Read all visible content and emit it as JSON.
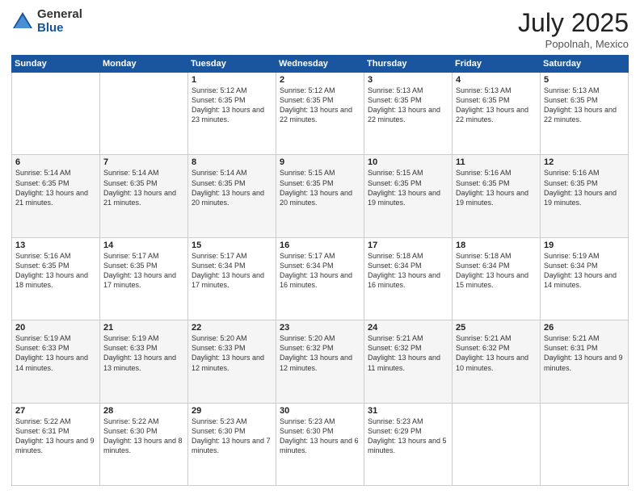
{
  "logo": {
    "general": "General",
    "blue": "Blue"
  },
  "title": "July 2025",
  "location": "Popolnah, Mexico",
  "days_header": [
    "Sunday",
    "Monday",
    "Tuesday",
    "Wednesday",
    "Thursday",
    "Friday",
    "Saturday"
  ],
  "weeks": [
    [
      {
        "day": "",
        "sunrise": "",
        "sunset": "",
        "daylight": ""
      },
      {
        "day": "",
        "sunrise": "",
        "sunset": "",
        "daylight": ""
      },
      {
        "day": "1",
        "sunrise": "Sunrise: 5:12 AM",
        "sunset": "Sunset: 6:35 PM",
        "daylight": "Daylight: 13 hours and 23 minutes."
      },
      {
        "day": "2",
        "sunrise": "Sunrise: 5:12 AM",
        "sunset": "Sunset: 6:35 PM",
        "daylight": "Daylight: 13 hours and 22 minutes."
      },
      {
        "day": "3",
        "sunrise": "Sunrise: 5:13 AM",
        "sunset": "Sunset: 6:35 PM",
        "daylight": "Daylight: 13 hours and 22 minutes."
      },
      {
        "day": "4",
        "sunrise": "Sunrise: 5:13 AM",
        "sunset": "Sunset: 6:35 PM",
        "daylight": "Daylight: 13 hours and 22 minutes."
      },
      {
        "day": "5",
        "sunrise": "Sunrise: 5:13 AM",
        "sunset": "Sunset: 6:35 PM",
        "daylight": "Daylight: 13 hours and 22 minutes."
      }
    ],
    [
      {
        "day": "6",
        "sunrise": "Sunrise: 5:14 AM",
        "sunset": "Sunset: 6:35 PM",
        "daylight": "Daylight: 13 hours and 21 minutes."
      },
      {
        "day": "7",
        "sunrise": "Sunrise: 5:14 AM",
        "sunset": "Sunset: 6:35 PM",
        "daylight": "Daylight: 13 hours and 21 minutes."
      },
      {
        "day": "8",
        "sunrise": "Sunrise: 5:14 AM",
        "sunset": "Sunset: 6:35 PM",
        "daylight": "Daylight: 13 hours and 20 minutes."
      },
      {
        "day": "9",
        "sunrise": "Sunrise: 5:15 AM",
        "sunset": "Sunset: 6:35 PM",
        "daylight": "Daylight: 13 hours and 20 minutes."
      },
      {
        "day": "10",
        "sunrise": "Sunrise: 5:15 AM",
        "sunset": "Sunset: 6:35 PM",
        "daylight": "Daylight: 13 hours and 19 minutes."
      },
      {
        "day": "11",
        "sunrise": "Sunrise: 5:16 AM",
        "sunset": "Sunset: 6:35 PM",
        "daylight": "Daylight: 13 hours and 19 minutes."
      },
      {
        "day": "12",
        "sunrise": "Sunrise: 5:16 AM",
        "sunset": "Sunset: 6:35 PM",
        "daylight": "Daylight: 13 hours and 19 minutes."
      }
    ],
    [
      {
        "day": "13",
        "sunrise": "Sunrise: 5:16 AM",
        "sunset": "Sunset: 6:35 PM",
        "daylight": "Daylight: 13 hours and 18 minutes."
      },
      {
        "day": "14",
        "sunrise": "Sunrise: 5:17 AM",
        "sunset": "Sunset: 6:35 PM",
        "daylight": "Daylight: 13 hours and 17 minutes."
      },
      {
        "day": "15",
        "sunrise": "Sunrise: 5:17 AM",
        "sunset": "Sunset: 6:34 PM",
        "daylight": "Daylight: 13 hours and 17 minutes."
      },
      {
        "day": "16",
        "sunrise": "Sunrise: 5:17 AM",
        "sunset": "Sunset: 6:34 PM",
        "daylight": "Daylight: 13 hours and 16 minutes."
      },
      {
        "day": "17",
        "sunrise": "Sunrise: 5:18 AM",
        "sunset": "Sunset: 6:34 PM",
        "daylight": "Daylight: 13 hours and 16 minutes."
      },
      {
        "day": "18",
        "sunrise": "Sunrise: 5:18 AM",
        "sunset": "Sunset: 6:34 PM",
        "daylight": "Daylight: 13 hours and 15 minutes."
      },
      {
        "day": "19",
        "sunrise": "Sunrise: 5:19 AM",
        "sunset": "Sunset: 6:34 PM",
        "daylight": "Daylight: 13 hours and 14 minutes."
      }
    ],
    [
      {
        "day": "20",
        "sunrise": "Sunrise: 5:19 AM",
        "sunset": "Sunset: 6:33 PM",
        "daylight": "Daylight: 13 hours and 14 minutes."
      },
      {
        "day": "21",
        "sunrise": "Sunrise: 5:19 AM",
        "sunset": "Sunset: 6:33 PM",
        "daylight": "Daylight: 13 hours and 13 minutes."
      },
      {
        "day": "22",
        "sunrise": "Sunrise: 5:20 AM",
        "sunset": "Sunset: 6:33 PM",
        "daylight": "Daylight: 13 hours and 12 minutes."
      },
      {
        "day": "23",
        "sunrise": "Sunrise: 5:20 AM",
        "sunset": "Sunset: 6:32 PM",
        "daylight": "Daylight: 13 hours and 12 minutes."
      },
      {
        "day": "24",
        "sunrise": "Sunrise: 5:21 AM",
        "sunset": "Sunset: 6:32 PM",
        "daylight": "Daylight: 13 hours and 11 minutes."
      },
      {
        "day": "25",
        "sunrise": "Sunrise: 5:21 AM",
        "sunset": "Sunset: 6:32 PM",
        "daylight": "Daylight: 13 hours and 10 minutes."
      },
      {
        "day": "26",
        "sunrise": "Sunrise: 5:21 AM",
        "sunset": "Sunset: 6:31 PM",
        "daylight": "Daylight: 13 hours and 9 minutes."
      }
    ],
    [
      {
        "day": "27",
        "sunrise": "Sunrise: 5:22 AM",
        "sunset": "Sunset: 6:31 PM",
        "daylight": "Daylight: 13 hours and 9 minutes."
      },
      {
        "day": "28",
        "sunrise": "Sunrise: 5:22 AM",
        "sunset": "Sunset: 6:30 PM",
        "daylight": "Daylight: 13 hours and 8 minutes."
      },
      {
        "day": "29",
        "sunrise": "Sunrise: 5:23 AM",
        "sunset": "Sunset: 6:30 PM",
        "daylight": "Daylight: 13 hours and 7 minutes."
      },
      {
        "day": "30",
        "sunrise": "Sunrise: 5:23 AM",
        "sunset": "Sunset: 6:30 PM",
        "daylight": "Daylight: 13 hours and 6 minutes."
      },
      {
        "day": "31",
        "sunrise": "Sunrise: 5:23 AM",
        "sunset": "Sunset: 6:29 PM",
        "daylight": "Daylight: 13 hours and 5 minutes."
      },
      {
        "day": "",
        "sunrise": "",
        "sunset": "",
        "daylight": ""
      },
      {
        "day": "",
        "sunrise": "",
        "sunset": "",
        "daylight": ""
      }
    ]
  ]
}
